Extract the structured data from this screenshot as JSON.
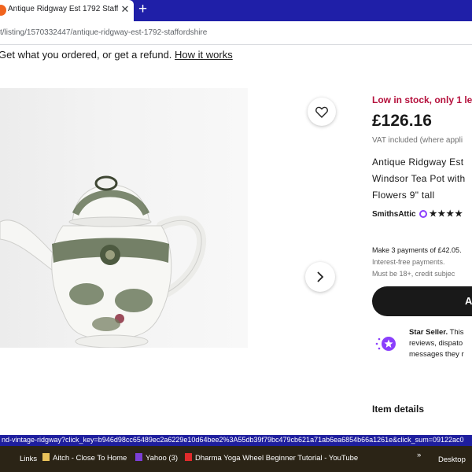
{
  "browser": {
    "tab_title": "Antique Ridgway Est 1792 Staffo",
    "tab_close": "✕",
    "new_tab": "+",
    "url": "t/listing/1570332447/antique-ridgway-est-1792-staffordshire"
  },
  "banner": {
    "text": "Get what you ordered, or get a refund.",
    "link": "How it works"
  },
  "listing": {
    "stock": "Low in stock, only 1 le",
    "price": "£126.16",
    "vat": "VAT included (where appli",
    "title_lines": [
      "Antique Ridgway Est",
      "Windsor Tea Pot with",
      "Flowers 9\" tall"
    ],
    "seller": "SmithsAttic",
    "rating_stars": "★★★★",
    "payments": "Make 3 payments of £42.05.",
    "interest": "Interest-free payments.",
    "age": "Must be 18+, credit subjec",
    "buy_button": "A",
    "star_seller_title": "Star Seller.",
    "star_seller_text1": "This",
    "star_seller_text2": "reviews, dispato",
    "star_seller_text3": "messages they r",
    "item_details": "Item details"
  },
  "status_url": "nd-vintage-ridgway?click_key=b946d98cc65489ec2a6229e10d64bee2%3A55db39f79bc479cb621a71ab6ea6854b66a1261e&click_sum=09122ac0",
  "taskbar": {
    "links": "Links",
    "items": [
      {
        "label": "Aitch - Close To Home",
        "color": "#e8c15a"
      },
      {
        "label": "Yahoo (3)",
        "color": "#7b3fd6"
      },
      {
        "label": "Dharma Yoga Wheel Beginner Tutorial - YouTube",
        "color": "#e02b2b"
      }
    ],
    "more": "»",
    "desktop": "Desktop"
  },
  "icons": {
    "favorite": "heart-icon",
    "next": "chevron-right-icon",
    "star_seller": "star-seller-icon"
  }
}
